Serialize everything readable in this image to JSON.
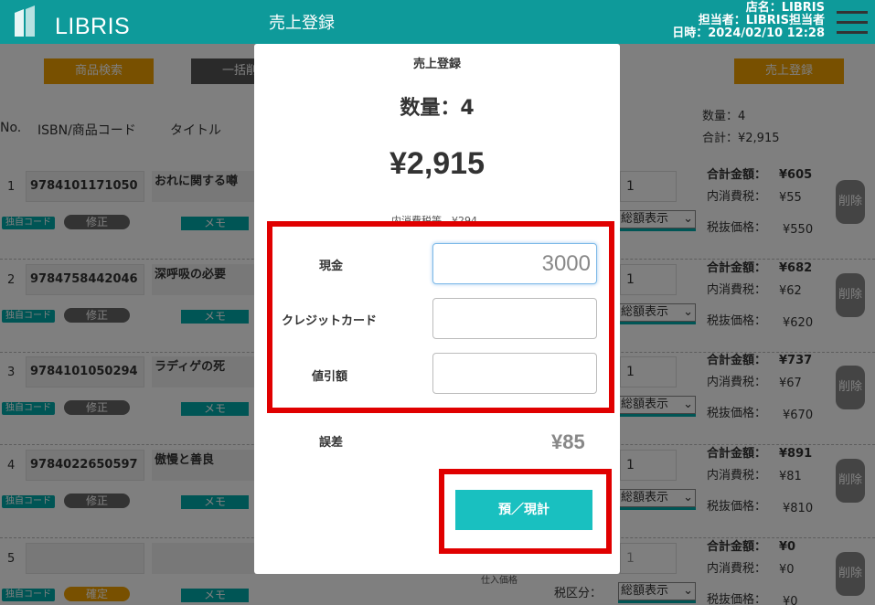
{
  "header": {
    "brand": "LIBRIS",
    "title": "売上登録",
    "store": "店名：LIBRIS",
    "staff": "担当者：LIBRIS担当者",
    "datetime": "日時：2024/02/10 12:28"
  },
  "toolbar": {
    "search_label": "商品検索",
    "bulk_label": "一括削除",
    "register_label": "売上登録"
  },
  "summary": {
    "qty": "数量：4",
    "total": "合計：¥2,915"
  },
  "columns": {
    "no": "No.",
    "isbn": "ISBN/商品コード",
    "title": "タイトル"
  },
  "rows": [
    {
      "no": "1",
      "isbn": "9784101171050",
      "title": "おれに関する噂",
      "tag": "独自コード",
      "fix": "修正",
      "memo": "メモ",
      "qty": "1",
      "tax_mode": "総額表示",
      "total_label": "合計金額：",
      "total": "¥605",
      "tax_label": "内消費税：",
      "tax": "¥55",
      "net_label": "税抜価格：",
      "net": "¥550",
      "del": "削除"
    },
    {
      "no": "2",
      "isbn": "9784758442046",
      "title": "深呼吸の必要",
      "tag": "独自コード",
      "fix": "修正",
      "memo": "メモ",
      "qty": "1",
      "tax_mode": "総額表示",
      "total_label": "合計金額：",
      "total": "¥682",
      "tax_label": "内消費税：",
      "tax": "¥62",
      "net_label": "税抜価格：",
      "net": "¥620",
      "del": "削除"
    },
    {
      "no": "3",
      "isbn": "9784101050294",
      "title": "ラディゲの死",
      "tag": "独自コード",
      "fix": "修正",
      "memo": "メモ",
      "qty": "1",
      "tax_mode": "総額表示",
      "total_label": "合計金額：",
      "total": "¥737",
      "tax_label": "内消費税：",
      "tax": "¥67",
      "net_label": "税抜価格：",
      "net": "¥670",
      "del": "削除"
    },
    {
      "no": "4",
      "isbn": "9784022650597",
      "title": "傲慢と善良",
      "tag": "独自コード",
      "fix": "修正",
      "memo": "メモ",
      "qty": "1",
      "tax_mode": "総額表示",
      "total_label": "合計金額：",
      "total": "¥891",
      "tax_label": "内消費税：",
      "tax": "¥81",
      "net_label": "税抜価格：",
      "net": "¥810",
      "del": "削除"
    },
    {
      "no": "5",
      "isbn": "",
      "title": "",
      "tag": "独自コード",
      "fix": "確定",
      "memo": "メモ",
      "qty": "1",
      "tax_mode": "総額表示",
      "tax_mode_label": "税区分：",
      "total_label": "合計金額：",
      "total": "¥0",
      "tax_label": "内消費税：",
      "tax": "¥0",
      "net_label": "税抜価格：",
      "net": "¥0",
      "del": "削除",
      "hint": "仕入価格"
    }
  ],
  "modal": {
    "title": "売上登録",
    "qty": "数量：4",
    "total": "¥2,915",
    "tax_note": "内消費税等　¥294",
    "cash_label": "現金",
    "cash_value": "3000",
    "card_label": "クレジットカード",
    "card_value": "",
    "discount_label": "値引額",
    "discount_value": "",
    "error_label": "誤差",
    "error_value": "¥85",
    "submit_label": "預／現計"
  },
  "colors": {
    "brand": "#0e9a9a",
    "accent": "#19c0c0",
    "orange": "#f0a000",
    "highlight": "#e00000"
  }
}
